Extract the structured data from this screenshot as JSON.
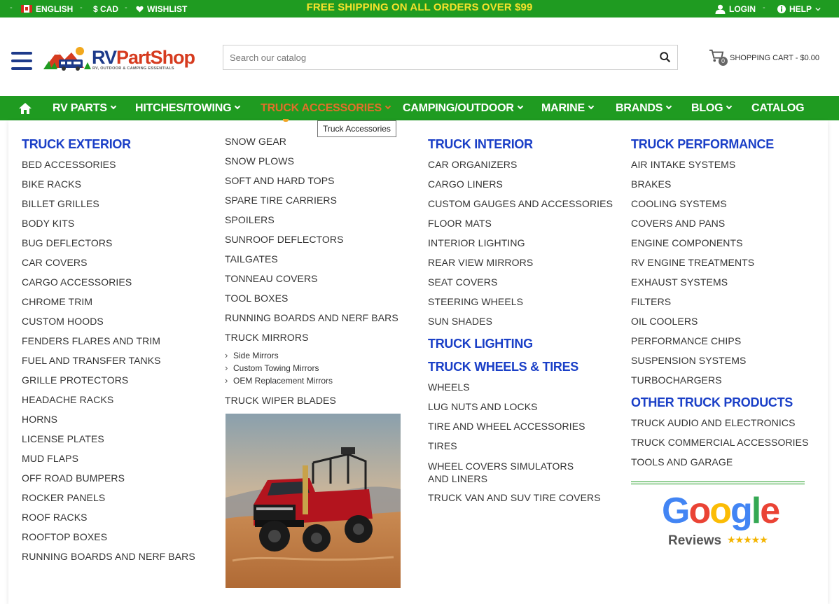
{
  "topbar": {
    "language": "ENGLISH",
    "currency": "$ CAD",
    "wishlist": "WISHLIST",
    "promo": "FREE SHIPPING ON ALL ORDERS OVER $99",
    "login": "LOGIN",
    "help": "HELP",
    "separator": "-"
  },
  "header": {
    "logo_main_1": "RV",
    "logo_main_2": "PartShop",
    "logo_sub": "RV, OUTDOOR & CAMPING ESSENTIALS",
    "search_placeholder": "Search our catalog",
    "cart_count": "0",
    "cart_label": "SHOPPING CART - $0.00"
  },
  "nav": {
    "items": [
      "RV PARTS",
      "HITCHES/TOWING",
      "TRUCK ACCESSORIES",
      "CAMPING/OUTDOOR",
      "MARINE",
      "BRANDS",
      "BLOG",
      "CATALOG"
    ],
    "active": "TRUCK ACCESSORIES",
    "tooltip": "Truck Accessories"
  },
  "mega": {
    "col1": {
      "heading": "TRUCK EXTERIOR",
      "links": [
        "BED ACCESSORIES",
        "BIKE RACKS",
        "BILLET GRILLES",
        "BODY KITS",
        "BUG DEFLECTORS",
        "CAR COVERS",
        "CARGO ACCESSORIES",
        "CHROME TRIM",
        "CUSTOM HOODS",
        "FENDERS FLARES AND TRIM",
        "FUEL AND TRANSFER TANKS",
        "GRILLE PROTECTORS",
        "HEADACHE RACKS",
        "HORNS",
        "LICENSE PLATES",
        "MUD FLAPS",
        "OFF ROAD BUMPERS",
        "ROCKER PANELS",
        "ROOF RACKS",
        "ROOFTOP BOXES",
        "RUNNING BOARDS AND NERF BARS"
      ]
    },
    "col2": {
      "links": [
        "SNOW GEAR",
        "SNOW PLOWS",
        "SOFT AND HARD TOPS",
        "SPARE TIRE CARRIERS",
        "SPOILERS",
        "SUNROOF DEFLECTORS",
        "TAILGATES",
        "TONNEAU COVERS",
        "TOOL BOXES",
        "RUNNING BOARDS AND NERF BARS",
        "TRUCK MIRRORS"
      ],
      "sublinks": [
        "Side Mirrors",
        "Custom Towing Mirrors",
        "OEM Replacement Mirrors"
      ],
      "last_link": "TRUCK WIPER BLADES"
    },
    "col3": {
      "heading": "TRUCK INTERIOR",
      "links": [
        "CAR ORGANIZERS",
        "CARGO LINERS",
        "CUSTOM GAUGES AND ACCESSORIES",
        "FLOOR MATS",
        "INTERIOR LIGHTING",
        "REAR VIEW MIRRORS",
        "SEAT COVERS",
        "STEERING WHEELS",
        "SUN SHADES"
      ],
      "heading2": "TRUCK LIGHTING",
      "heading3": "TRUCK WHEELS & TIRES",
      "links2": [
        "WHEELS",
        "LUG NUTS AND LOCKS",
        "TIRE AND WHEEL ACCESSORIES",
        "TIRES",
        "WHEEL COVERS SIMULATORS AND LINERS",
        "TRUCK VAN AND SUV TIRE COVERS"
      ]
    },
    "col4": {
      "heading": "TRUCK PERFORMANCE",
      "links": [
        "AIR INTAKE SYSTEMS",
        "BRAKES",
        "COOLING SYSTEMS",
        "COVERS AND PANS",
        "ENGINE COMPONENTS",
        "RV ENGINE TREATMENTS",
        "EXHAUST SYSTEMS",
        "FILTERS",
        "OIL COOLERS",
        "PERFORMANCE CHIPS",
        "SUSPENSION SYSTEMS",
        "TURBOCHARGERS"
      ],
      "heading2": "OTHER TRUCK PRODUCTS",
      "links2": [
        "TRUCK AUDIO AND ELECTRONICS",
        "TRUCK COMMERCIAL ACCESSORIES",
        "TOOLS AND GARAGE"
      ],
      "google_word": "Google",
      "google_reviews": "Reviews",
      "google_stars": "★★★★★"
    }
  },
  "colors": {
    "green": "#1f9b21",
    "promo_yellow": "#f6e12c",
    "heading_blue": "#1a3fc7",
    "active_orange": "#e0702a",
    "navy": "#1d3a8a"
  }
}
